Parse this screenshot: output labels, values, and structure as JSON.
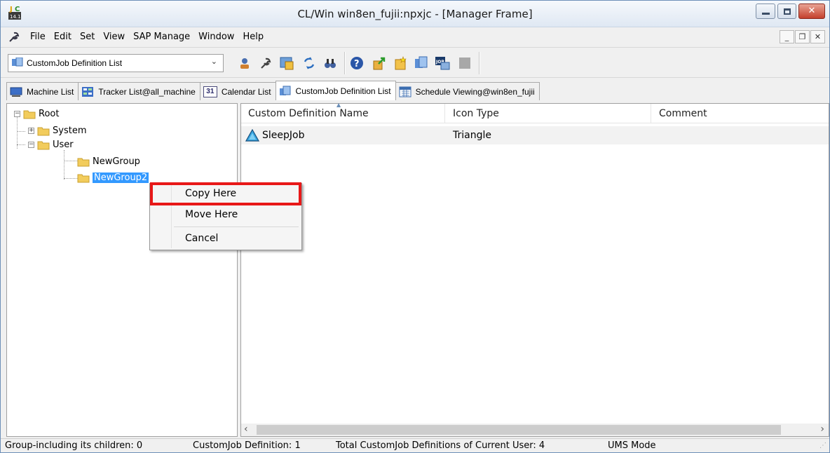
{
  "window": {
    "title": "CL/Win win8en_fujii:npxjc - [Manager Frame]"
  },
  "menubar": {
    "items": [
      "File",
      "Edit",
      "Set",
      "View",
      "SAP Manage",
      "Window",
      "Help"
    ]
  },
  "toolbar": {
    "combo_value": "CustomJob Definition List",
    "icons": [
      "user-icon",
      "wrench-icon",
      "picture-icon",
      "refresh-icon",
      "binoculars-icon",
      "help-icon",
      "export-icon",
      "new-icon",
      "customjob-icon",
      "job-icon",
      "stop-icon"
    ]
  },
  "tabs": [
    {
      "label": "Machine List",
      "icon": "computer-icon"
    },
    {
      "label": "Tracker List@all_machine",
      "icon": "tracker-icon"
    },
    {
      "label": "Calendar List",
      "icon": "calendar-icon",
      "icon_text": "31"
    },
    {
      "label": "CustomJob Definition List",
      "icon": "customjob-icon",
      "active": true
    },
    {
      "label": "Schedule Viewing@win8en_fujii",
      "icon": "schedule-icon"
    }
  ],
  "tree": {
    "root": "Root",
    "system": "System",
    "user": "User",
    "group1": "NewGroup",
    "group2": "NewGroup2"
  },
  "list": {
    "columns": [
      "Custom Definition Name",
      "Icon Type",
      "Comment"
    ],
    "rows": [
      {
        "name": "SleepJob",
        "icon_type": "Triangle",
        "comment": ""
      }
    ]
  },
  "context_menu": {
    "copy": "Copy Here",
    "move": "Move Here",
    "cancel": "Cancel"
  },
  "statusbar": {
    "group": "Group-including its children: 0",
    "customjob": "CustomJob Definition: 1",
    "total": "Total CustomJob Definitions of Current User: 4",
    "mode": "UMS Mode"
  },
  "colors": {
    "highlight": "#e81818",
    "selection": "#3399ff"
  }
}
